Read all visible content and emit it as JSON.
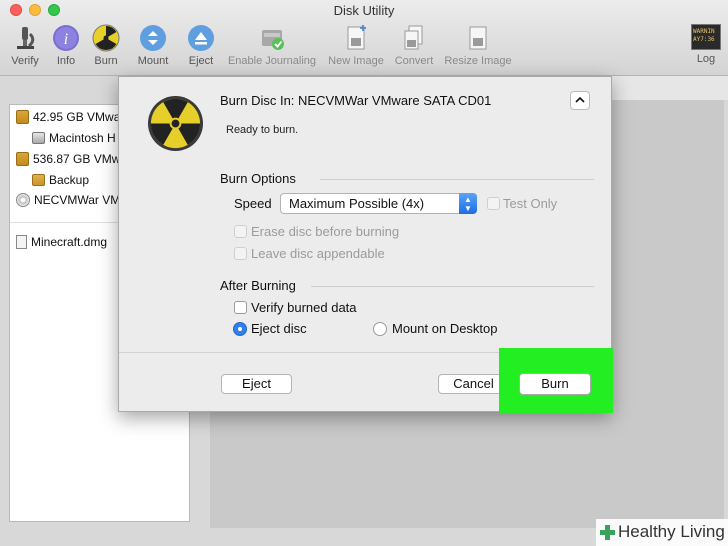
{
  "window": {
    "title": "Disk Utility"
  },
  "toolbar": [
    {
      "label": "Verify",
      "icon": "microscope-icon"
    },
    {
      "label": "Info",
      "icon": "info-icon"
    },
    {
      "label": "Burn",
      "icon": "radiation-icon"
    },
    {
      "label": "Mount",
      "icon": "mount-icon"
    },
    {
      "label": "Eject",
      "icon": "eject-icon"
    },
    {
      "label": "Enable Journaling",
      "icon": "journaling-icon"
    },
    {
      "label": "New Image",
      "icon": "new-image-icon"
    },
    {
      "label": "Convert",
      "icon": "convert-icon"
    },
    {
      "label": "Resize Image",
      "icon": "resize-image-icon"
    },
    {
      "label": "Log",
      "icon": "log-icon",
      "badge": "WARNIN AY7:36"
    }
  ],
  "sidebar": {
    "items": [
      {
        "label": "42.95 GB VMwa"
      },
      {
        "label": "Macintosh H"
      },
      {
        "label": "536.87 GB VMw"
      },
      {
        "label": "Backup"
      },
      {
        "label": "NECVMWar VMw"
      },
      {
        "label": "Minecraft.dmg"
      }
    ]
  },
  "dialog": {
    "title": "Burn Disc In:  NECVMWar VMware SATA CD01",
    "status": "Ready to burn.",
    "burn_options": "Burn Options",
    "speed_label": "Speed",
    "speed_value": "Maximum Possible (4x)",
    "test_only": "Test Only",
    "erase": "Erase disc before burning",
    "leave_appendable": "Leave disc appendable",
    "after_burning": "After Burning",
    "verify": "Verify burned data",
    "eject_disc": "Eject disc",
    "mount_desktop": "Mount on Desktop",
    "eject_button": "Eject",
    "cancel_button": "Cancel",
    "burn_button": "Burn"
  },
  "watermark": {
    "text": "Healthy Living"
  },
  "colors": {
    "highlight": "#22ee22",
    "accent": "#2f7ff0"
  }
}
